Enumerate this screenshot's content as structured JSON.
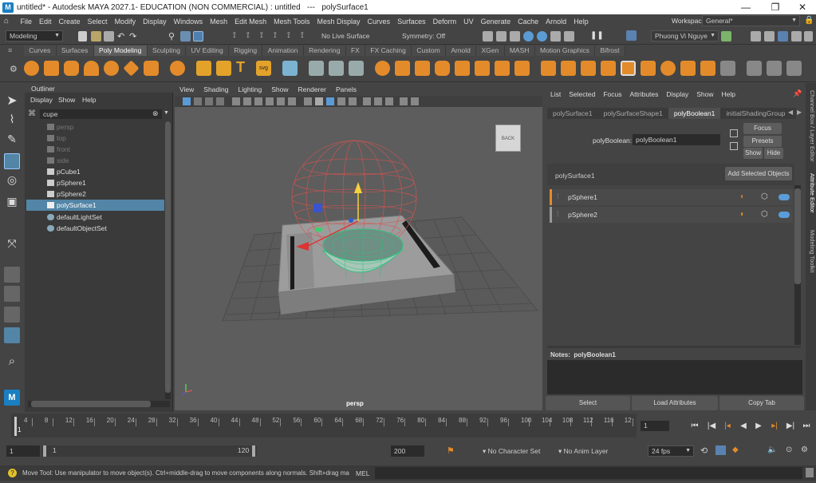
{
  "window": {
    "title": "untitled* - Autodesk MAYA 2027.1- EDUCATION (NON COMMERCIAL) : untitled   ---   polySurface1",
    "logo": "M",
    "minimize": "—",
    "maximize": "❐",
    "close": "✕"
  },
  "menubar": {
    "items": [
      "File",
      "Edit",
      "Create",
      "Select",
      "Modify",
      "Display",
      "Windows",
      "Mesh",
      "Edit Mesh",
      "Mesh Tools",
      "Mesh Display",
      "Curves",
      "Surfaces",
      "Deform",
      "UV",
      "Generate",
      "Cache",
      "Arnold",
      "Help"
    ],
    "workspace_label": "Workspace:",
    "workspace_value": "General*"
  },
  "statusline": {
    "mode": "Modeling",
    "live_surface": "No Live Surface",
    "symmetry": "Symmetry: Off",
    "user": "Phuong Vi Nguye"
  },
  "shelf": {
    "tabs": [
      "Curves",
      "Surfaces",
      "Poly Modeling",
      "Sculpting",
      "UV Editing",
      "Rigging",
      "Animation",
      "Rendering",
      "FX",
      "FX Caching",
      "Custom",
      "Arnold",
      "XGen",
      "MASH",
      "Motion Graphics",
      "Bifrost"
    ],
    "active_tab": "Poly Modeling"
  },
  "outliner": {
    "title": "Outliner",
    "menu": [
      "Display",
      "Show",
      "Help"
    ],
    "search_value": "cupe",
    "items": [
      {
        "label": "persp",
        "dim": true,
        "icon": "camera-icon"
      },
      {
        "label": "top",
        "dim": true,
        "icon": "camera-icon"
      },
      {
        "label": "front",
        "dim": true,
        "icon": "camera-icon"
      },
      {
        "label": "side",
        "dim": true,
        "icon": "camera-icon"
      },
      {
        "label": "pCube1",
        "dim": false,
        "icon": "mesh-icon"
      },
      {
        "label": "pSphere1",
        "dim": false,
        "icon": "mesh-icon"
      },
      {
        "label": "pSphere2",
        "dim": false,
        "icon": "mesh-icon"
      },
      {
        "label": "polySurface1",
        "dim": false,
        "icon": "mesh-icon",
        "selected": true
      },
      {
        "label": "defaultLightSet",
        "dim": false,
        "icon": "set-icon"
      },
      {
        "label": "defaultObjectSet",
        "dim": false,
        "icon": "set-icon"
      }
    ]
  },
  "viewport": {
    "menu": [
      "View",
      "Shading",
      "Lighting",
      "Show",
      "Renderer",
      "Panels"
    ],
    "camera_label": "persp",
    "viewcube_label": "BACK"
  },
  "attribute_editor": {
    "menu": [
      "List",
      "Selected",
      "Focus",
      "Attributes",
      "Display",
      "Show",
      "Help"
    ],
    "tabs": [
      "polySurface1",
      "polySurfaceShape1",
      "polyBoolean1",
      "initialShadingGroup"
    ],
    "active_tab": "polyBoolean1",
    "node_label": "polyBoolean:",
    "node_value": "polyBoolean1",
    "focus_btn": "Focus",
    "presets_btn": "Presets",
    "show_btn": "Show",
    "hide_btn": "Hide",
    "surface_label": "polySurface1",
    "add_btn": "Add Selected Objects",
    "objects": [
      "pSphere1",
      "pSphere2"
    ],
    "notes": "Notes:  polyBoolean1",
    "bottom_buttons": [
      "Select",
      "Load Attributes",
      "Copy Tab"
    ]
  },
  "right_tabs": [
    "Channel Box / Layer Editor",
    "Attribute Editor",
    "Modeling Toolkit"
  ],
  "timeline": {
    "ticks": [
      "4",
      "8",
      "12",
      "16",
      "20",
      "24",
      "28",
      "32",
      "36",
      "40",
      "44",
      "48",
      "52",
      "56",
      "60",
      "64",
      "68",
      "72",
      "76",
      "80",
      "84",
      "88",
      "92",
      "96",
      "100",
      "104",
      "108",
      "112",
      "116",
      "12"
    ],
    "start": "1",
    "current_frame": "1"
  },
  "rangebar": {
    "start": "1",
    "range_start": "1",
    "range_end": "120",
    "end": "200",
    "character_set": "No Character Set",
    "anim_layer": "No Anim Layer",
    "fps": "24 fps"
  },
  "helpline": {
    "text": "Move Tool: Use manipulator to move object(s). Ctrl+middle-drag to move components along normals. Shift+drag manipulator a",
    "mel": "MEL"
  }
}
